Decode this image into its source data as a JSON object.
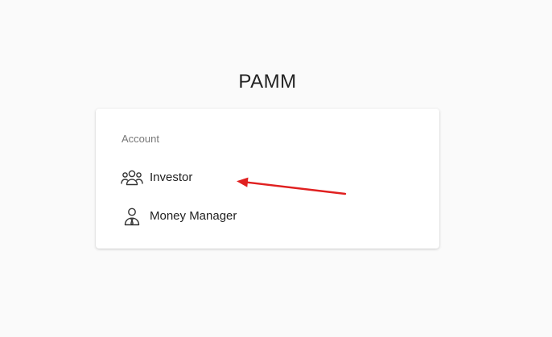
{
  "page": {
    "title": "PAMM"
  },
  "account": {
    "section_label": "Account",
    "items": [
      {
        "label": "Investor",
        "icon": "users-group-icon"
      },
      {
        "label": "Money Manager",
        "icon": "manager-tie-icon"
      }
    ]
  },
  "annotation": {
    "arrow_color": "#e02020"
  }
}
